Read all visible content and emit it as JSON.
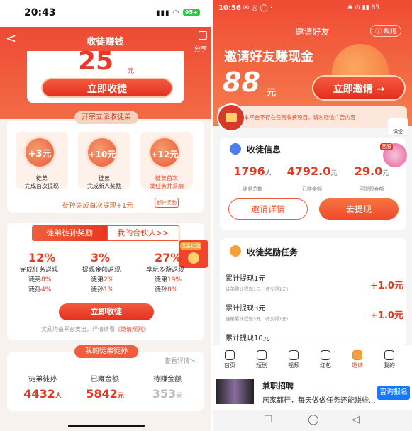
{
  "left": {
    "status": {
      "time": "20:43",
      "signal": "▮▮▮ ◠",
      "battery": "95+"
    },
    "header": {
      "back": "<",
      "title": "收徒赚钱",
      "share": "分享"
    },
    "hero": {
      "amount": "25",
      "unit": "元",
      "cta": "立即收徒"
    },
    "card1": {
      "pill": "开宗立派收徒弟",
      "tiles": [
        {
          "amount": "+3元",
          "line1": "徒弟",
          "line2": "完成首次提现",
          "accent": false
        },
        {
          "amount": "+10元",
          "line1": "徒弟",
          "line2": "完成新人奖励",
          "accent": false
        },
        {
          "amount": "+12元",
          "line1": "徒弟首次",
          "line2": "发任务并采纳",
          "accent": true
        }
      ],
      "note": "徒孙完成首次提现+1元",
      "tag": "额外奖励"
    },
    "card2": {
      "tab_active": "徒弟徒孙奖励",
      "tab_inactive": "我的合伙人>>",
      "cols": [
        {
          "pct": "12%",
          "desc": "完成任务返现",
          "r1a": "徒弟",
          "r1b": "8%",
          "r2a": "徒孙",
          "r2b": "4%"
        },
        {
          "pct": "3%",
          "desc": "提现金额返现",
          "r1a": "徒弟",
          "r1b": "2%",
          "r2a": "徒孙",
          "r2b": "1%"
        },
        {
          "pct": "27%",
          "desc": "享玩多游返现",
          "r1a": "徒弟",
          "r1b": "19%",
          "r2a": "徒孙",
          "r2b": "8%"
        }
      ],
      "redpack": "现金红包",
      "cta": "立即收徒",
      "note_pre": "奖励均由平台支出，详情请看",
      "note_link": "《邀请规则》"
    },
    "card3": {
      "pill": "我的徒弟徒孙",
      "more": "查看详情>",
      "stats": [
        {
          "label": "徒弟徒孙",
          "value": "4432",
          "unit": "人",
          "color": "#e03b21"
        },
        {
          "label": "已赚金额",
          "value": "5842",
          "unit": "元",
          "color": "#e03b21"
        },
        {
          "label": "待赚金额",
          "value": "353",
          "unit": "元",
          "color": "#bbbbbb"
        }
      ]
    }
  },
  "right": {
    "status": {
      "time": "10:56",
      "icons": "✉ ◎ ◯ ·",
      "right": "✱ ⊙ ▮▮ 85"
    },
    "header": {
      "title": "邀请好友",
      "rule": "ⓘ 规则"
    },
    "hero": {
      "headline": "邀请好友赚现金",
      "amount": "88",
      "unit": "元",
      "cta": "立即邀请 →"
    },
    "notice": "本平台不存在任何收费项目，请勿轻信广告内容",
    "badge": "课堂",
    "info": {
      "title": "收徒信息",
      "service": "客服",
      "stats": [
        {
          "value": "1796",
          "unit": "人",
          "label": "徒弟总数"
        },
        {
          "value": "4792.0",
          "unit": "元",
          "label": "已赚金额"
        },
        {
          "value": "29.0",
          "unit": "元",
          "label": "可提现金额"
        }
      ],
      "btn_detail": "邀请详情",
      "btn_withdraw": "去提现"
    },
    "tasks": {
      "title": "收徒奖励任务",
      "items": [
        {
          "title": "累计提现1元",
          "sub": "徒弟累计提现1元，师父得1元!",
          "reward": "+1.0元"
        },
        {
          "title": "累计提现3元",
          "sub": "徒弟累计提现3元，师父得1元!",
          "reward": "+1.0元"
        },
        {
          "title": "累计提现10元",
          "sub": "",
          "reward": ""
        }
      ]
    },
    "tabbar": [
      {
        "label": "首页",
        "active": false
      },
      {
        "label": "短剧",
        "active": false
      },
      {
        "label": "视频",
        "active": false
      },
      {
        "label": "红包",
        "active": false
      },
      {
        "label": "邀请",
        "active": true
      },
      {
        "label": "我的",
        "active": false
      }
    ],
    "ad": {
      "title": "兼职招聘",
      "desc": "居家都行，每天做做任务还能赚些...",
      "cta": "咨询报名"
    },
    "nav": [
      "☐",
      "◯",
      "◁"
    ]
  },
  "colors": {
    "brand": "#e83a2a",
    "accent": "#f26b47"
  }
}
